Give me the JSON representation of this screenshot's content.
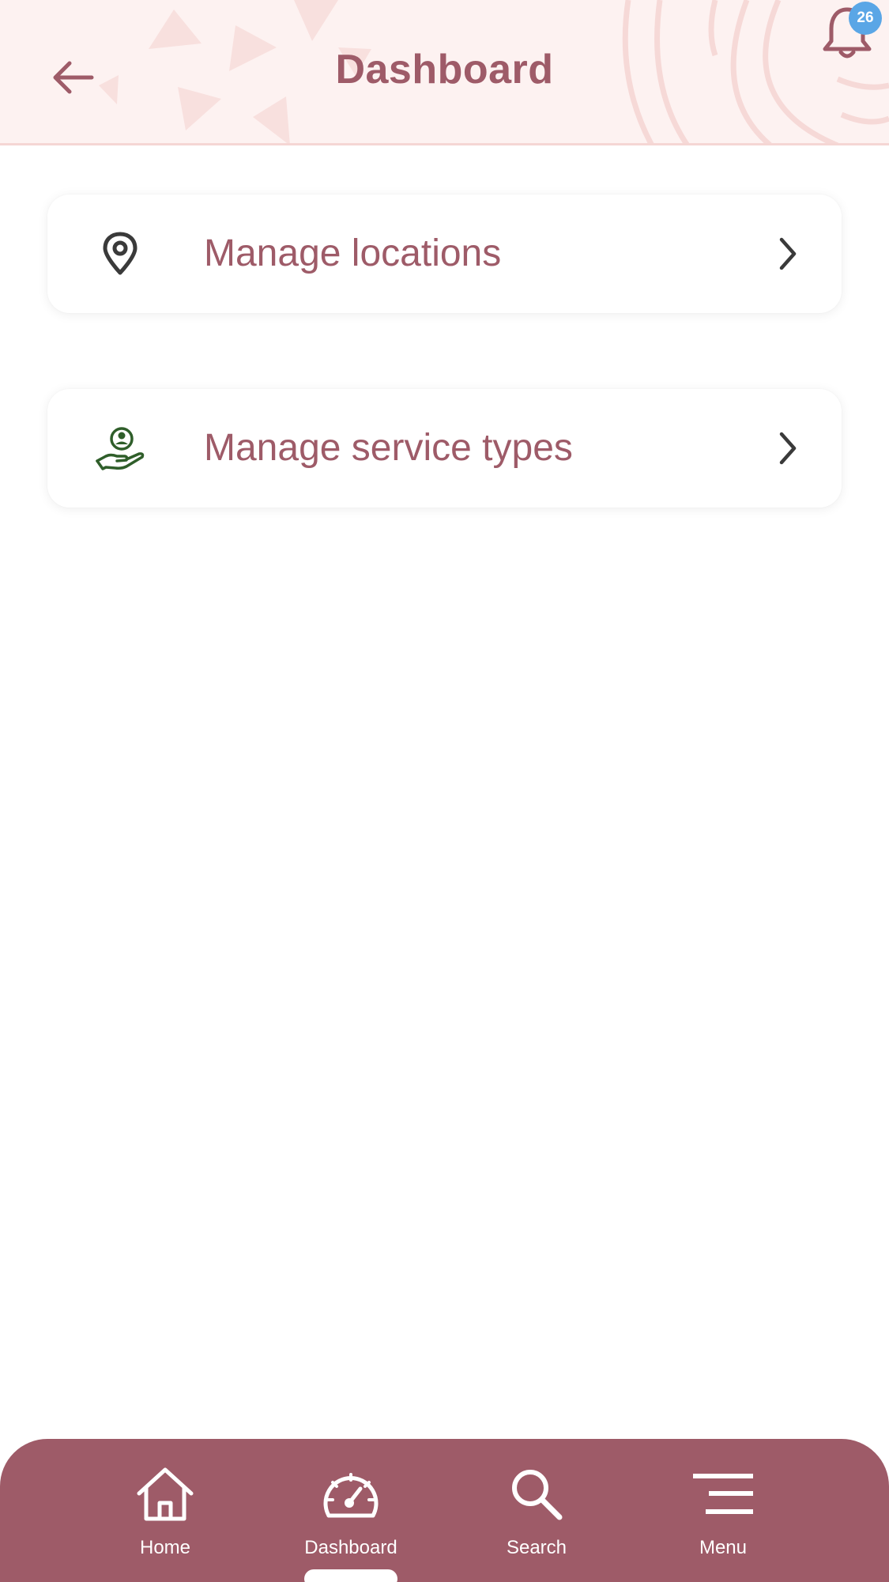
{
  "header": {
    "title": "Dashboard",
    "back_icon": "arrow-left-icon",
    "notifications": {
      "icon": "bell-icon",
      "badge_count": "26",
      "badge_color": "#5aa6e6"
    }
  },
  "cards": [
    {
      "label": "Manage locations",
      "icon": "map-pin-icon",
      "icon_color": "#3a3a3a",
      "chevron": "chevron-right-icon"
    },
    {
      "label": "Manage service types",
      "icon": "hand-person-icon",
      "icon_color": "#2f5e2a",
      "chevron": "chevron-right-icon"
    }
  ],
  "bottom_nav": {
    "background": "#9e5b68",
    "active": "Dashboard",
    "items": [
      {
        "label": "Home",
        "icon": "home-icon"
      },
      {
        "label": "Dashboard",
        "icon": "speedometer-icon"
      },
      {
        "label": "Search",
        "icon": "search-icon"
      },
      {
        "label": "Menu",
        "icon": "menu-icon"
      }
    ]
  },
  "colors": {
    "accent": "#9e5b68",
    "header_bg": "#fdf2f1"
  }
}
